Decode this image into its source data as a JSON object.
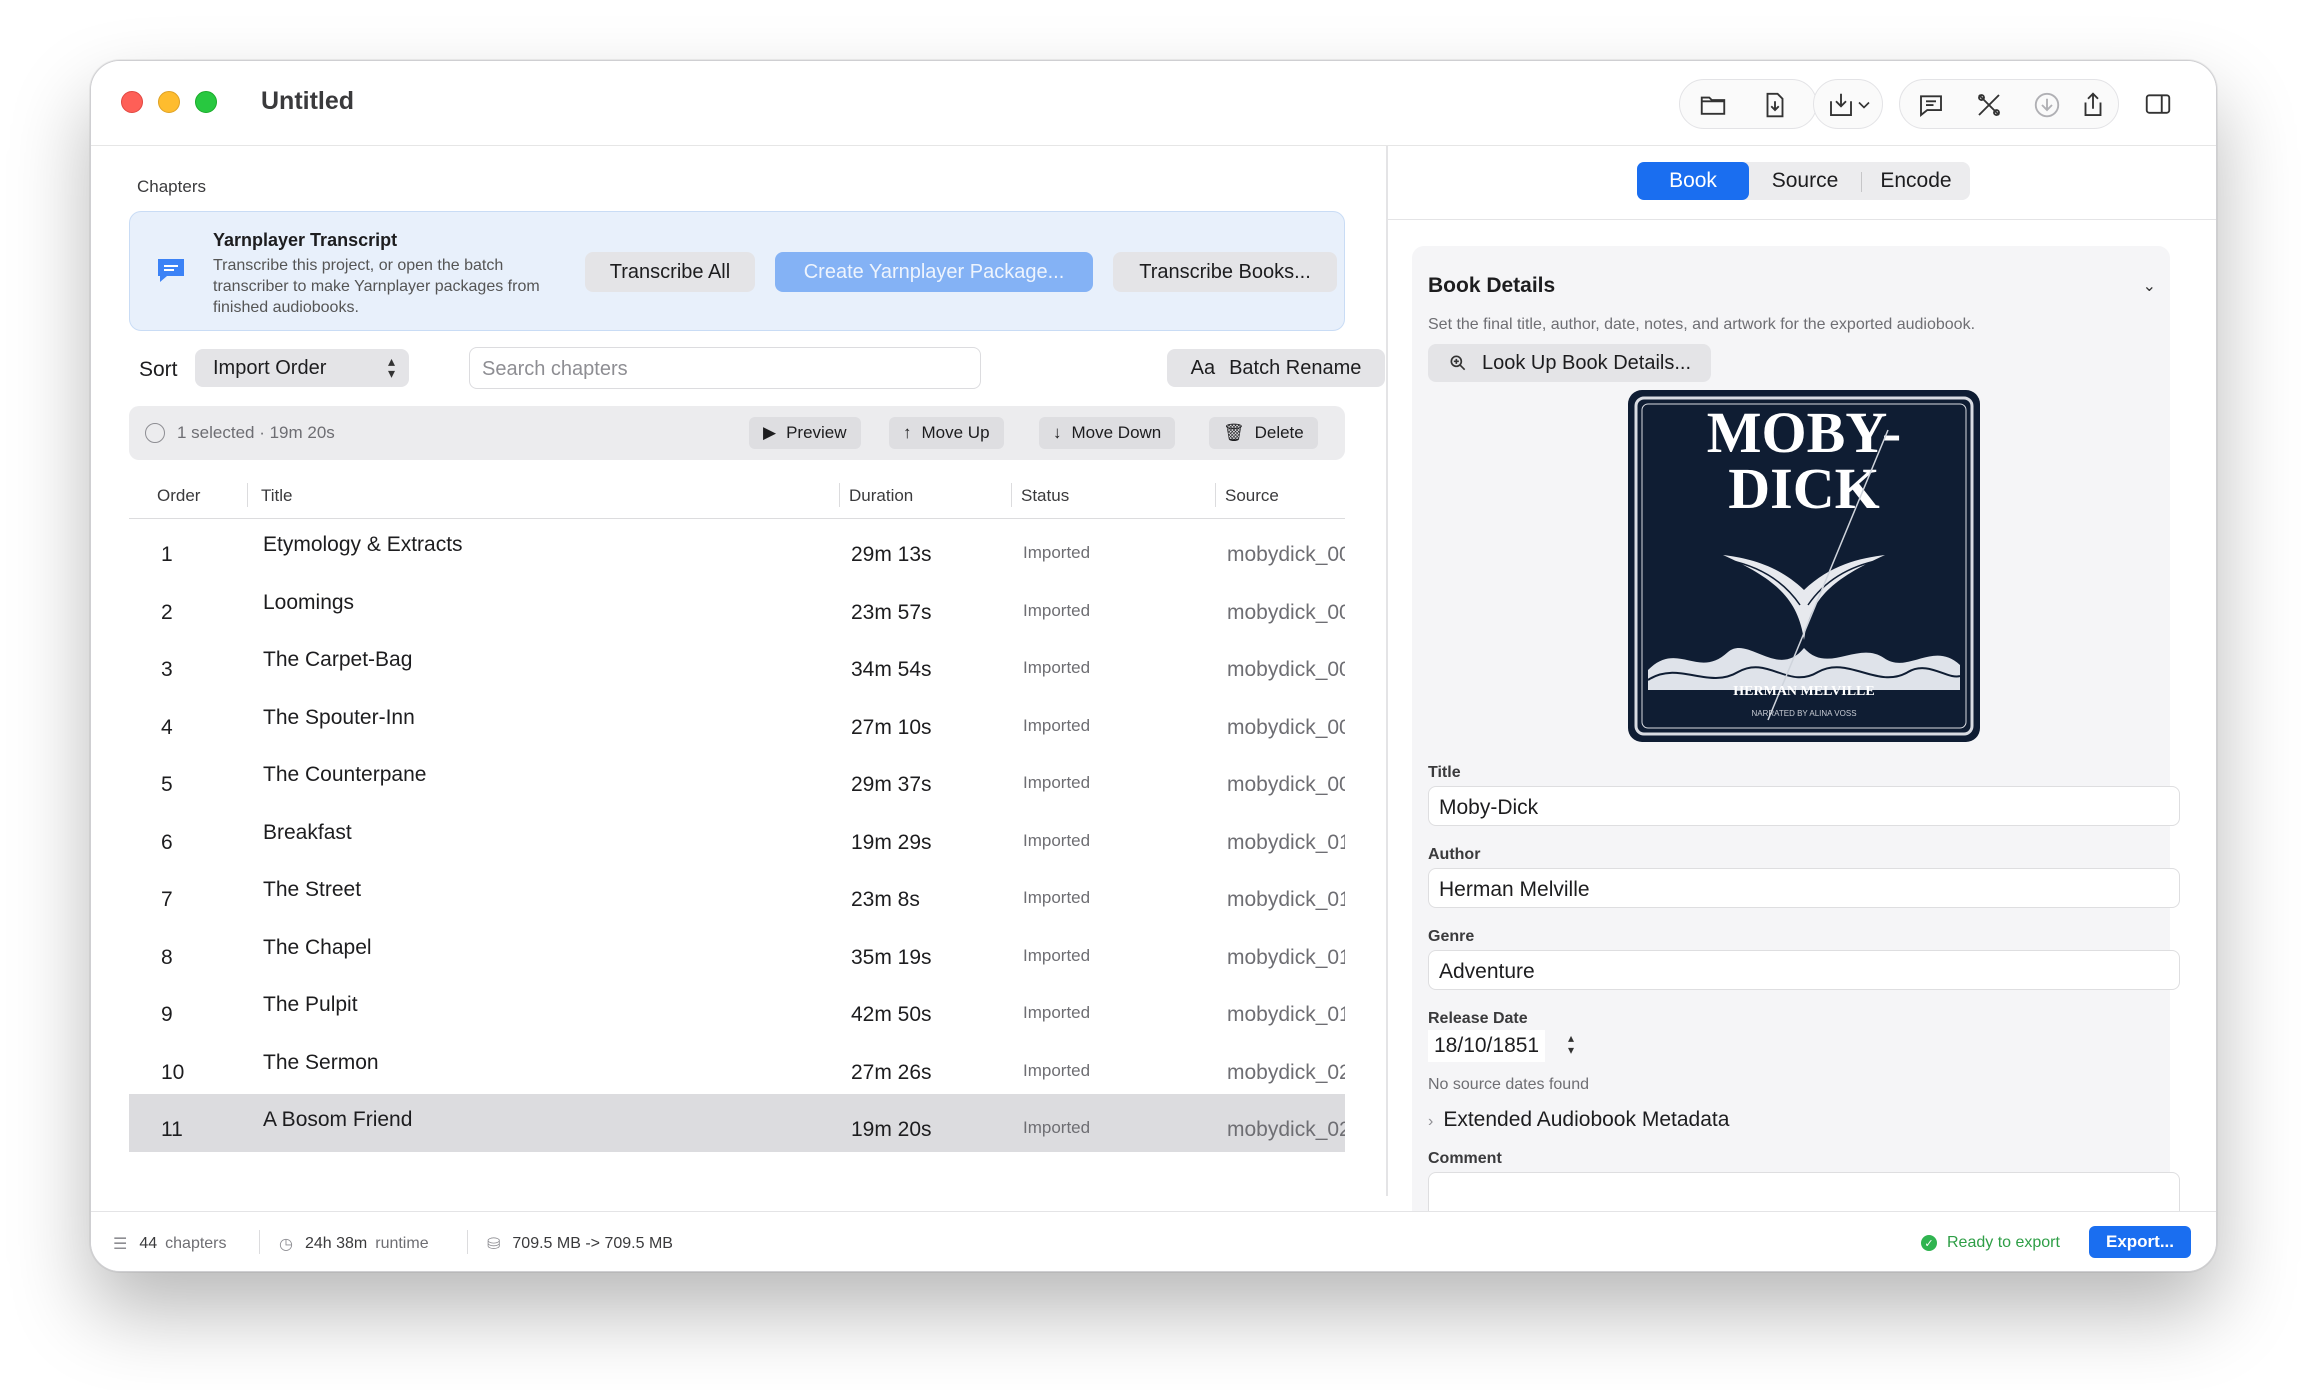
{
  "window": {
    "title": "Untitled"
  },
  "toolbar": {
    "icons": [
      "folder-icon",
      "document-download-icon",
      "import-menu-icon",
      "chat-bubble-icon",
      "tools-icon",
      "download-circle-icon",
      "share-icon",
      "sidebar-toggle-icon"
    ]
  },
  "chapters": {
    "section_label": "Chapters",
    "banner": {
      "title": "Yarnplayer Transcript",
      "description": "Transcribe this project, or open the batch transcriber to make Yarnplayer packages from finished audiobooks.",
      "buttons": {
        "transcribe_all": "Transcribe All",
        "create_package": "Create Yarnplayer Package...",
        "transcribe_books": "Transcribe Books..."
      }
    },
    "sort_label": "Sort",
    "sort_value": "Import Order",
    "search_placeholder": "Search chapters",
    "batch_rename_prefix": "Aa",
    "batch_rename": "Batch Rename",
    "selection_text": "1 selected · 19m 20s",
    "actions": {
      "preview": "Preview",
      "move_up": "Move Up",
      "move_down": "Move Down",
      "delete": "Delete"
    },
    "columns": [
      "Order",
      "Title",
      "Duration",
      "Status",
      "Source"
    ],
    "rows": [
      {
        "order": "1",
        "title": "Etymology & Extracts",
        "duration": "29m 13s",
        "status": "Imported",
        "source": "mobydick_00"
      },
      {
        "order": "2",
        "title": "Loomings",
        "duration": "23m 57s",
        "status": "Imported",
        "source": "mobydick_00"
      },
      {
        "order": "3",
        "title": "The Carpet-Bag",
        "duration": "34m 54s",
        "status": "Imported",
        "source": "mobydick_00"
      },
      {
        "order": "4",
        "title": "The Spouter-Inn",
        "duration": "27m 10s",
        "status": "Imported",
        "source": "mobydick_00"
      },
      {
        "order": "5",
        "title": "The Counterpane",
        "duration": "29m 37s",
        "status": "Imported",
        "source": "mobydick_00"
      },
      {
        "order": "6",
        "title": "Breakfast",
        "duration": "19m 29s",
        "status": "Imported",
        "source": "mobydick_01"
      },
      {
        "order": "7",
        "title": "The Street",
        "duration": "23m 8s",
        "status": "Imported",
        "source": "mobydick_01"
      },
      {
        "order": "8",
        "title": "The Chapel",
        "duration": "35m 19s",
        "status": "Imported",
        "source": "mobydick_01"
      },
      {
        "order": "9",
        "title": "The Pulpit",
        "duration": "42m 50s",
        "status": "Imported",
        "source": "mobydick_01"
      },
      {
        "order": "10",
        "title": "The Sermon",
        "duration": "27m 26s",
        "status": "Imported",
        "source": "mobydick_02"
      },
      {
        "order": "11",
        "title": "A Bosom Friend",
        "duration": "19m 20s",
        "status": "Imported",
        "source": "mobydick_02",
        "selected": true
      }
    ]
  },
  "statusbar": {
    "chapter_count": "44",
    "chapter_unit": "chapters",
    "runtime": "24h 38m",
    "runtime_unit": "runtime",
    "size": "709.5 MB -> 709.5 MB",
    "ready": "Ready to export",
    "export": "Export..."
  },
  "inspector": {
    "tabs": [
      "Book",
      "Source",
      "Encode"
    ],
    "active_tab": "Book",
    "section_title": "Book Details",
    "section_desc": "Set the final title, author, date, notes, and artwork for the exported audiobook.",
    "lookup_button": "Look Up Book Details...",
    "cover": {
      "title_line1": "MOBY-",
      "title_line2": "DICK",
      "author": "HERMAN MELVILLE",
      "narrator": "NARRATED BY ALINA VOSS"
    },
    "fields": {
      "title_label": "Title",
      "title_value": "Moby-Dick",
      "author_label": "Author",
      "author_value": "Herman Melville",
      "genre_label": "Genre",
      "genre_value": "Adventure",
      "release_label": "Release Date",
      "release_value": "18/10/1851",
      "release_hint": "No source dates found",
      "extended": "Extended Audiobook Metadata",
      "comment_label": "Comment"
    }
  },
  "colors": {
    "accent": "#1a6ef0",
    "ready_green": "#2e9e46",
    "banner_bg": "#e8f0fb"
  }
}
